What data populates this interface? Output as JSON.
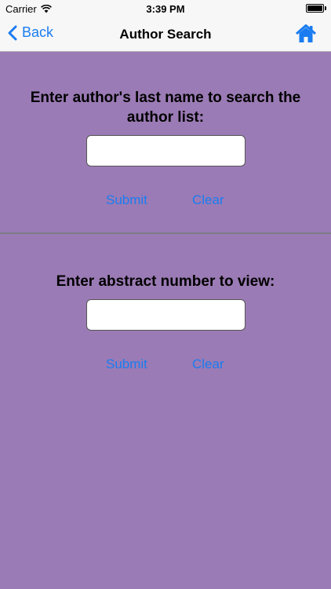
{
  "status_bar": {
    "carrier": "Carrier",
    "time": "3:39 PM"
  },
  "nav_bar": {
    "back_label": "Back",
    "title": "Author Search",
    "home_icon": "home-icon",
    "accent_color": "#1a7cf0"
  },
  "author_search": {
    "prompt": "Enter author's last name to search the author list:",
    "input_value": "",
    "submit_label": "Submit",
    "clear_label": "Clear"
  },
  "abstract_view": {
    "prompt": "Enter abstract number to view:",
    "input_value": "",
    "submit_label": "Submit",
    "clear_label": "Clear"
  },
  "colors": {
    "background": "#9b7bb5",
    "bar_background": "#f7f7f7",
    "link": "#1a7cf0"
  }
}
